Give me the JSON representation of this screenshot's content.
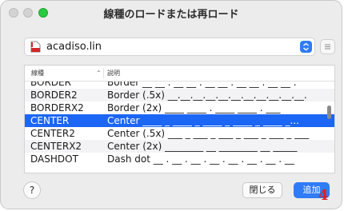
{
  "window": {
    "title": "線種のロードまたは再ロード"
  },
  "file": {
    "name": "acadiso.lin"
  },
  "table": {
    "headers": {
      "name": "線種",
      "description": "説明"
    },
    "rows": [
      {
        "name": "BORDER",
        "description": "Border __ __ . __ __ . __ __ . __ __ . __ __ ."
      },
      {
        "name": "BORDER2",
        "description": "Border (.5x) __.__.__.__.__.__.__.__.__.__.__."
      },
      {
        "name": "BORDERX2",
        "description": "Border (2x) ____ ____ . ____ ____ . ___"
      },
      {
        "name": "CENTER",
        "description": "Center ____ _ ____ _ ____ _ ____ _ ____ _...",
        "selected": true
      },
      {
        "name": "CENTER2",
        "description": "Center (.5x) ___ _ ___ _ ___ _ ___ _ ___ _ ___"
      },
      {
        "name": "CENTERX2",
        "description": "Center (2x) ________ __ ________ __ _____"
      },
      {
        "name": "DASHDOT",
        "description": "Dash dot __ . __ . __ . __ . __ . __ . __ . __"
      }
    ]
  },
  "buttons": {
    "help": "?",
    "close": "閉じる",
    "add": "追加"
  },
  "annotation": {
    "step": "4"
  },
  "colors": {
    "accent": "#1b66f5",
    "button_blue": "#2f7cf6",
    "annotation_red": "#e41e1e"
  }
}
